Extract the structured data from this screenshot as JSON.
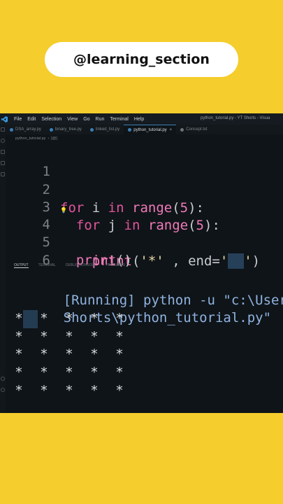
{
  "channel": {
    "handle": "@learning_section"
  },
  "menubar": {
    "items": [
      "File",
      "Edit",
      "Selection",
      "View",
      "Go",
      "Run",
      "Terminal",
      "Help"
    ],
    "window_title": "python_tutorial.py - YT Shorts - Visua"
  },
  "tabs": [
    {
      "label": "DSA_array.py",
      "active": false
    },
    {
      "label": "binary_tree.py",
      "active": false
    },
    {
      "label": "linked_list.py",
      "active": false
    },
    {
      "label": "python_tutorial.py",
      "active": true,
      "close": "×"
    },
    {
      "label": "Concept.txt",
      "active": false
    }
  ],
  "breadcrumb": {
    "file": "python_tutorial.py",
    "symbol": "[@]"
  },
  "editor": {
    "line_numbers": [
      "1",
      "2",
      "3",
      "4",
      "5",
      "6"
    ],
    "lines": [
      {
        "tokens": []
      },
      {
        "tokens": [
          [
            "kw",
            "for"
          ],
          [
            "var",
            " i "
          ],
          [
            "kw",
            "in"
          ],
          [
            "var",
            " "
          ],
          [
            "fn",
            "range"
          ],
          [
            "punc",
            "("
          ],
          [
            "num",
            "5"
          ],
          [
            "punc",
            "):"
          ]
        ]
      },
      {
        "tokens": [
          [
            "var",
            "  "
          ],
          [
            "kw",
            "for"
          ],
          [
            "var",
            " j "
          ],
          [
            "kw",
            "in"
          ],
          [
            "var",
            " "
          ],
          [
            "fn",
            "range"
          ],
          [
            "punc",
            "("
          ],
          [
            "num",
            "5"
          ],
          [
            "punc",
            "):"
          ]
        ]
      },
      {
        "tokens": [
          [
            "var",
            "    "
          ],
          [
            "fn",
            "print"
          ],
          [
            "punc",
            "("
          ],
          [
            "str",
            "'*'"
          ],
          [
            "punc",
            " , "
          ],
          [
            "var",
            "end"
          ],
          [
            "punc",
            "="
          ],
          [
            "str",
            "'"
          ],
          [
            "sel",
            "  "
          ],
          [
            "str",
            "'"
          ],
          [
            "punc",
            ")"
          ]
        ]
      },
      {
        "tokens": [
          [
            "var",
            "  "
          ],
          [
            "fn",
            "print"
          ],
          [
            "punc",
            "()"
          ]
        ]
      },
      {
        "tokens": []
      }
    ]
  },
  "panel": {
    "tabs": [
      "OUTPUT",
      "TERMINAL",
      "DEBUG CONSOLE",
      "PROBLEMS"
    ],
    "active": "OUTPUT"
  },
  "terminal": {
    "running": "[Running] python -u \"c:\\Users\\kus",
    "running_cont": "Shorts\\python_tutorial.py\"",
    "star_rows": [
      [
        "*",
        "*",
        "*",
        "*",
        "*"
      ],
      [
        "*",
        "*",
        "*",
        "*",
        "*"
      ],
      [
        "*",
        "*",
        "*",
        "*",
        "*"
      ],
      [
        "*",
        "*",
        "*",
        "*",
        "*"
      ],
      [
        "*",
        "*",
        "*",
        "*",
        "*"
      ]
    ]
  },
  "colors": {
    "background": "#f5cd2c",
    "editor_bg": "#0f1418",
    "keyword": "#e0559a",
    "string": "#e8d9a8",
    "running": "#8fb3e0"
  }
}
